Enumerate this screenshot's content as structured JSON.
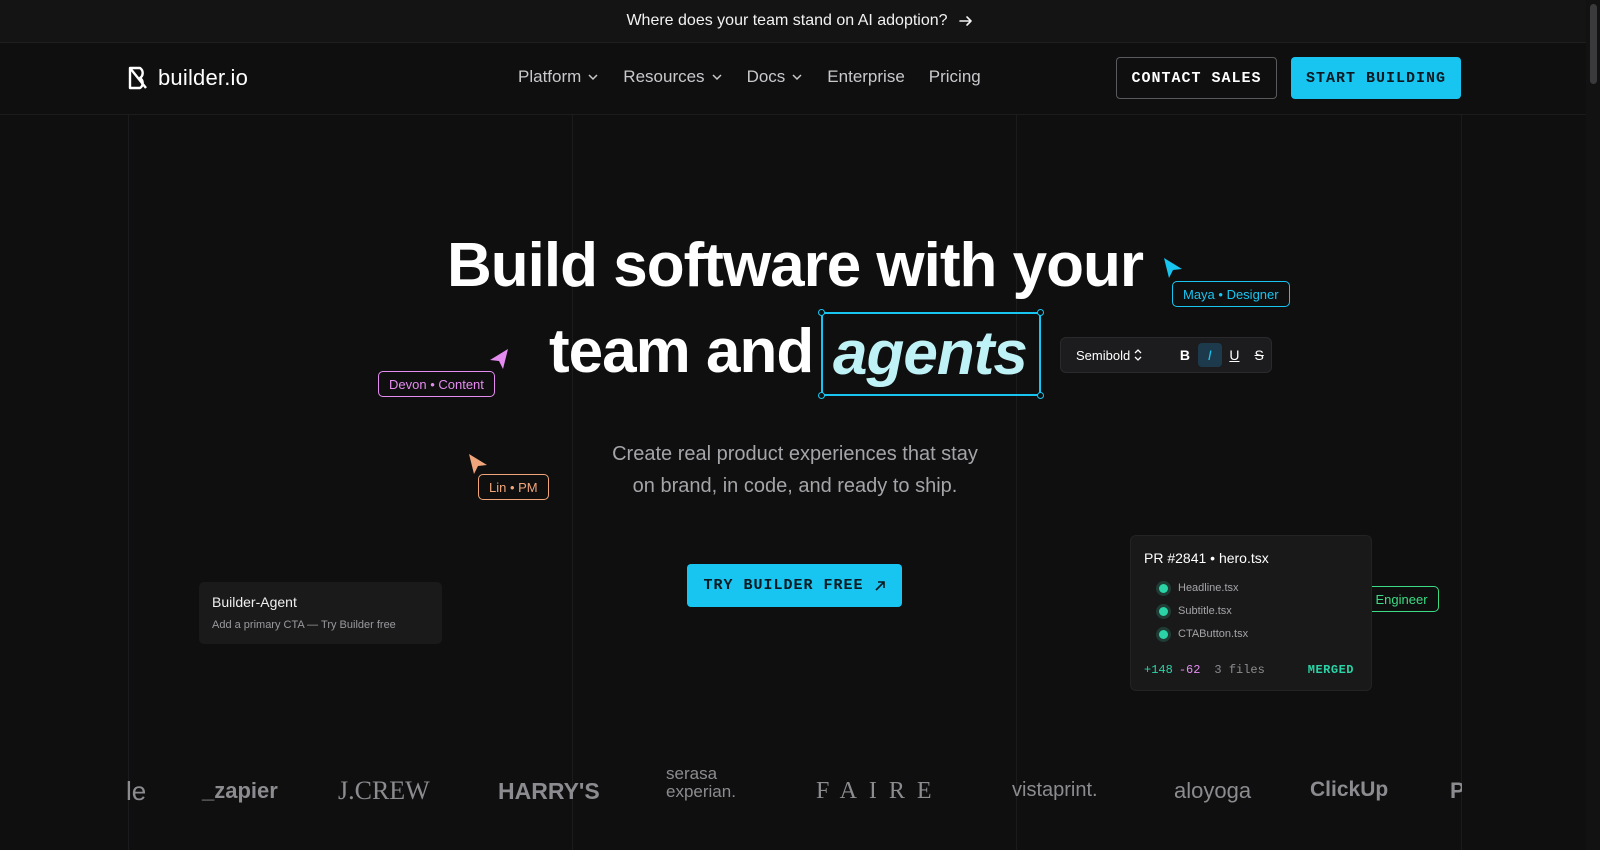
{
  "banner": {
    "text": "Where does your team stand on AI adoption?",
    "arrow_icon": "arrow-right-icon"
  },
  "nav": {
    "logo_text": "builder.io",
    "links": [
      {
        "label": "Platform",
        "has_dropdown": true
      },
      {
        "label": "Resources",
        "has_dropdown": true
      },
      {
        "label": "Docs",
        "has_dropdown": true
      },
      {
        "label": "Enterprise",
        "has_dropdown": false
      },
      {
        "label": "Pricing",
        "has_dropdown": false
      }
    ],
    "contact_label": "CONTACT SALES",
    "start_label": "START BUILDING"
  },
  "hero": {
    "line1": "Build software with your",
    "line2": "team and",
    "highlight": "agents",
    "subtitle_line1": "Create real product experiences that stay",
    "subtitle_line2": "on brand, in code, and ready to ship.",
    "cta_label": "TRY BUILDER FREE"
  },
  "toolbar": {
    "font_weight": "Semibold",
    "bold": "B",
    "italic": "I",
    "underline": "U",
    "strike": "S"
  },
  "collaborators": {
    "maya": "Maya • Designer",
    "devon": "Devon • Content",
    "lin": "Lin • PM",
    "sam": "Sam • Engineer"
  },
  "agent_card": {
    "title": "Builder-Agent",
    "message": "Add a primary CTA — Try Builder free"
  },
  "pr_card": {
    "title": "PR #2841 • hero.tsx",
    "files": [
      "Headline.tsx",
      "Subtitle.tsx",
      "CTAButton.tsx"
    ],
    "additions": "+148",
    "deletions": "-62",
    "file_count": "3 files",
    "status": "MERGED"
  },
  "logos": [
    "le",
    "_zapier",
    "J.CREW",
    "HARRY'S",
    "serasa experian.",
    "FAIRE",
    "vistaprint.",
    "aloyoga",
    "ClickUp",
    "P"
  ],
  "colors": {
    "accent": "#18c5f0",
    "background": "#0f0f10",
    "maya": "#18c5f0",
    "devon": "#e58cf0",
    "lin": "#f0a67a",
    "sam": "#3ddc84",
    "merged": "#2ad4a6"
  }
}
